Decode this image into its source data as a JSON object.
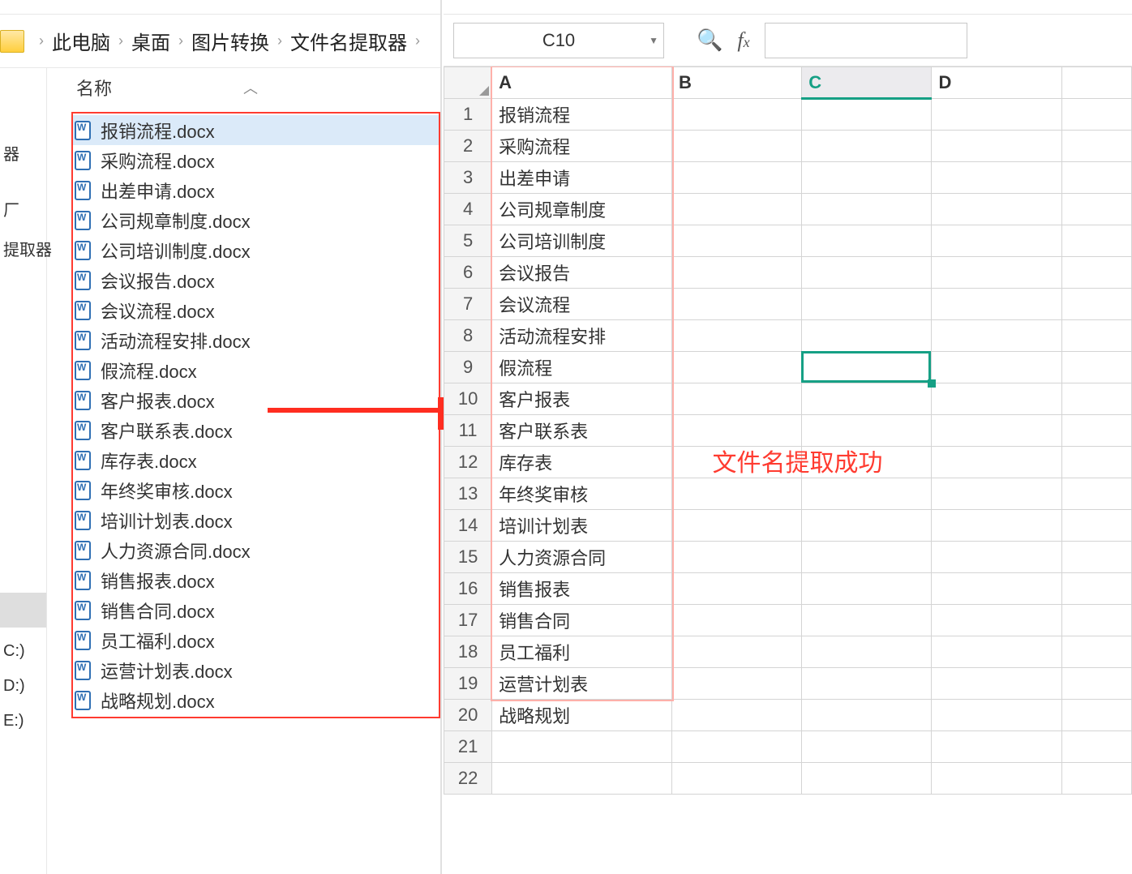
{
  "breadcrumb": {
    "items": [
      "此电脑",
      "桌面",
      "图片转换",
      "文件名提取器"
    ]
  },
  "sidebar_fragments": {
    "a": "器",
    "b": "厂",
    "c": "提取器",
    "drive_c": "C:)",
    "drive_d": "D:)",
    "drive_e": "E:)"
  },
  "column_header": "名称",
  "files": [
    "报销流程.docx",
    "采购流程.docx",
    "出差申请.docx",
    "公司规章制度.docx",
    "公司培训制度.docx",
    "会议报告.docx",
    "会议流程.docx",
    "活动流程安排.docx",
    "假流程.docx",
    "客户报表.docx",
    "客户联系表.docx",
    "库存表.docx",
    "年终奖审核.docx",
    "培训计划表.docx",
    "人力资源合同.docx",
    "销售报表.docx",
    "销售合同.docx",
    "员工福利.docx",
    "运营计划表.docx",
    "战略规划.docx"
  ],
  "spreadsheet": {
    "name_box": "C10",
    "columns": [
      "A",
      "B",
      "C",
      "D"
    ],
    "selected_cell": "C10",
    "selected_row": 10,
    "columnA": [
      "报销流程",
      "采购流程",
      "出差申请",
      "公司规章制度",
      "公司培训制度",
      "会议报告",
      "会议流程",
      "活动流程安排",
      "假流程",
      "客户报表",
      "客户联系表",
      "库存表",
      "年终奖审核",
      "培训计划表",
      "人力资源合同",
      "销售报表",
      "销售合同",
      "员工福利",
      "运营计划表",
      "战略规划"
    ],
    "row_count": 22
  },
  "annotation": "文件名提取成功"
}
